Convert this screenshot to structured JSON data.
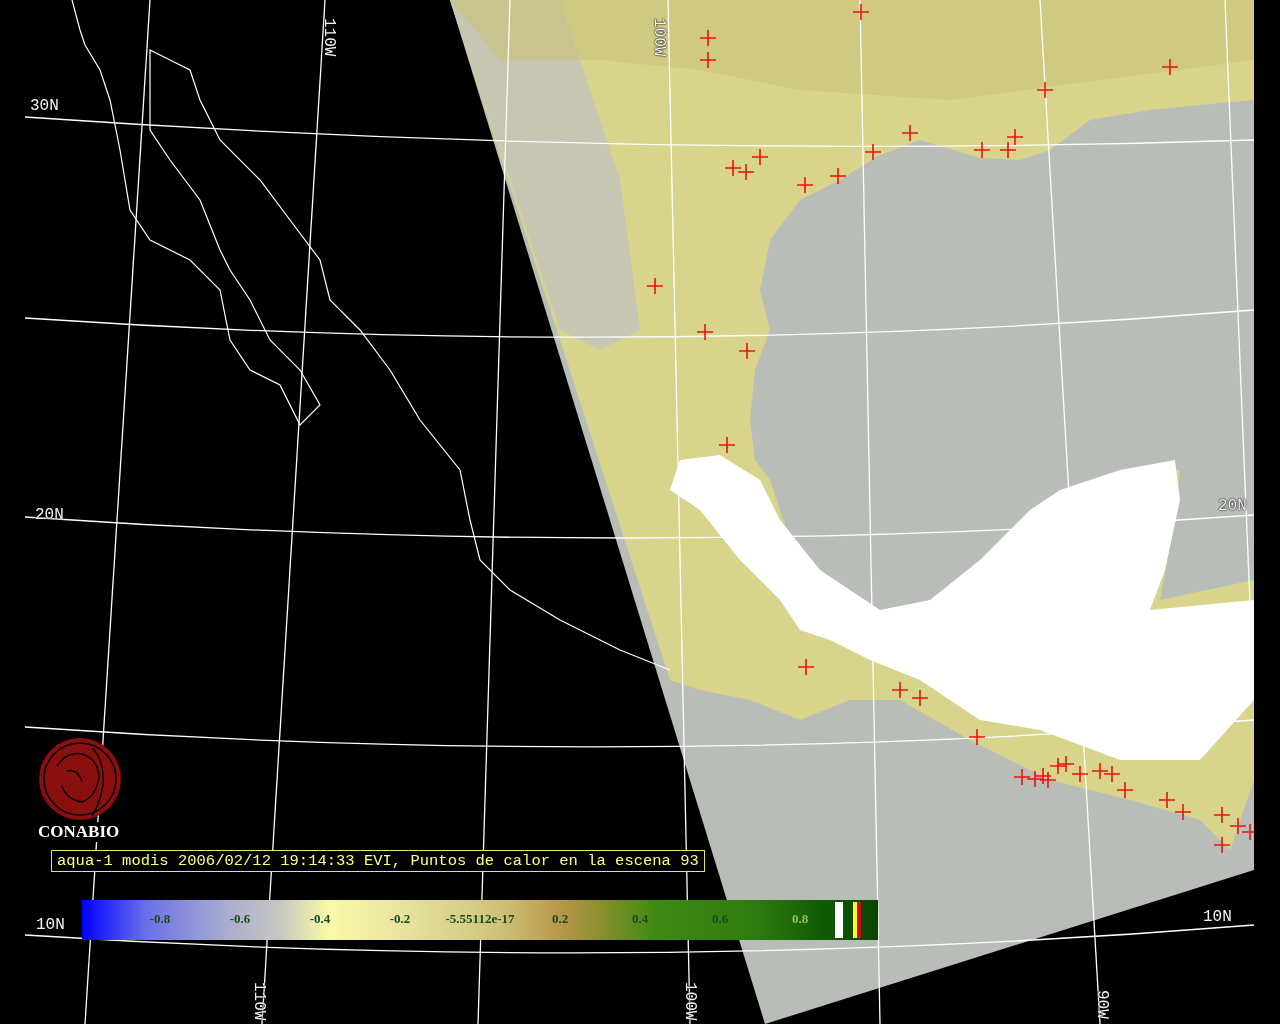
{
  "map": {
    "graticule_labels": [
      {
        "text": "30N"
      },
      {
        "text": "20N"
      },
      {
        "text": "10N"
      },
      {
        "text": "110W"
      },
      {
        "text": "100W"
      },
      {
        "text": "110W"
      },
      {
        "text": "100W"
      },
      {
        "text": "90W"
      },
      {
        "text": "20N"
      },
      {
        "text": "10N"
      }
    ]
  },
  "logo": {
    "name": "CONABIO"
  },
  "caption": "aqua-1 modis 2006/02/12 19:14:33 EVI, Puntos de calor en la escena 93",
  "color_scale": {
    "ticks": [
      "-0.8",
      "-0.6",
      "-0.4",
      "-0.2",
      "-5.55112e-17",
      "0.2",
      "0.4",
      "0.6",
      "0.8"
    ]
  }
}
